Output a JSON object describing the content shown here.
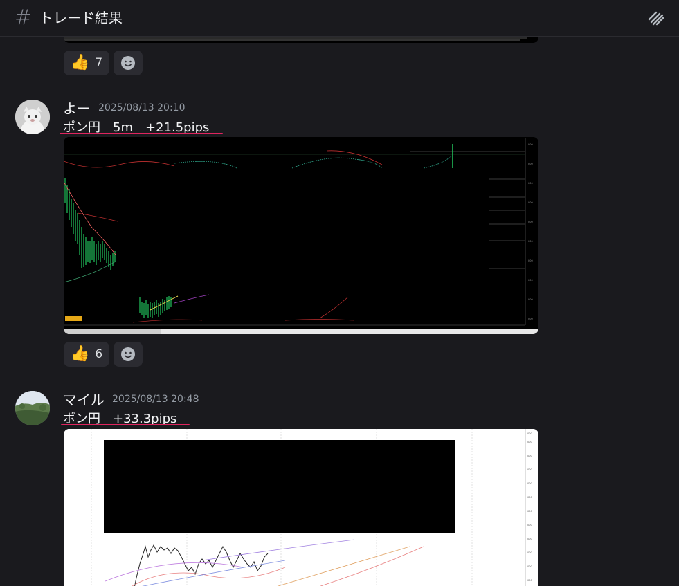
{
  "channel": {
    "name": "トレード結果"
  },
  "top_reactions": {
    "thumbs_count": "7"
  },
  "messages": [
    {
      "author": "よー",
      "timestamp": "2025/08/13 20:10",
      "text": "ポン円　5m　+21.5pips",
      "thumbs_count": "6"
    },
    {
      "author": "マイル",
      "timestamp": "2025/08/13 20:48",
      "text": "ポン円　+33.3pips"
    }
  ],
  "colors": {
    "background": "#1a1a1e",
    "underline": "#e0245e",
    "reaction_bg": "#2b2b31"
  }
}
